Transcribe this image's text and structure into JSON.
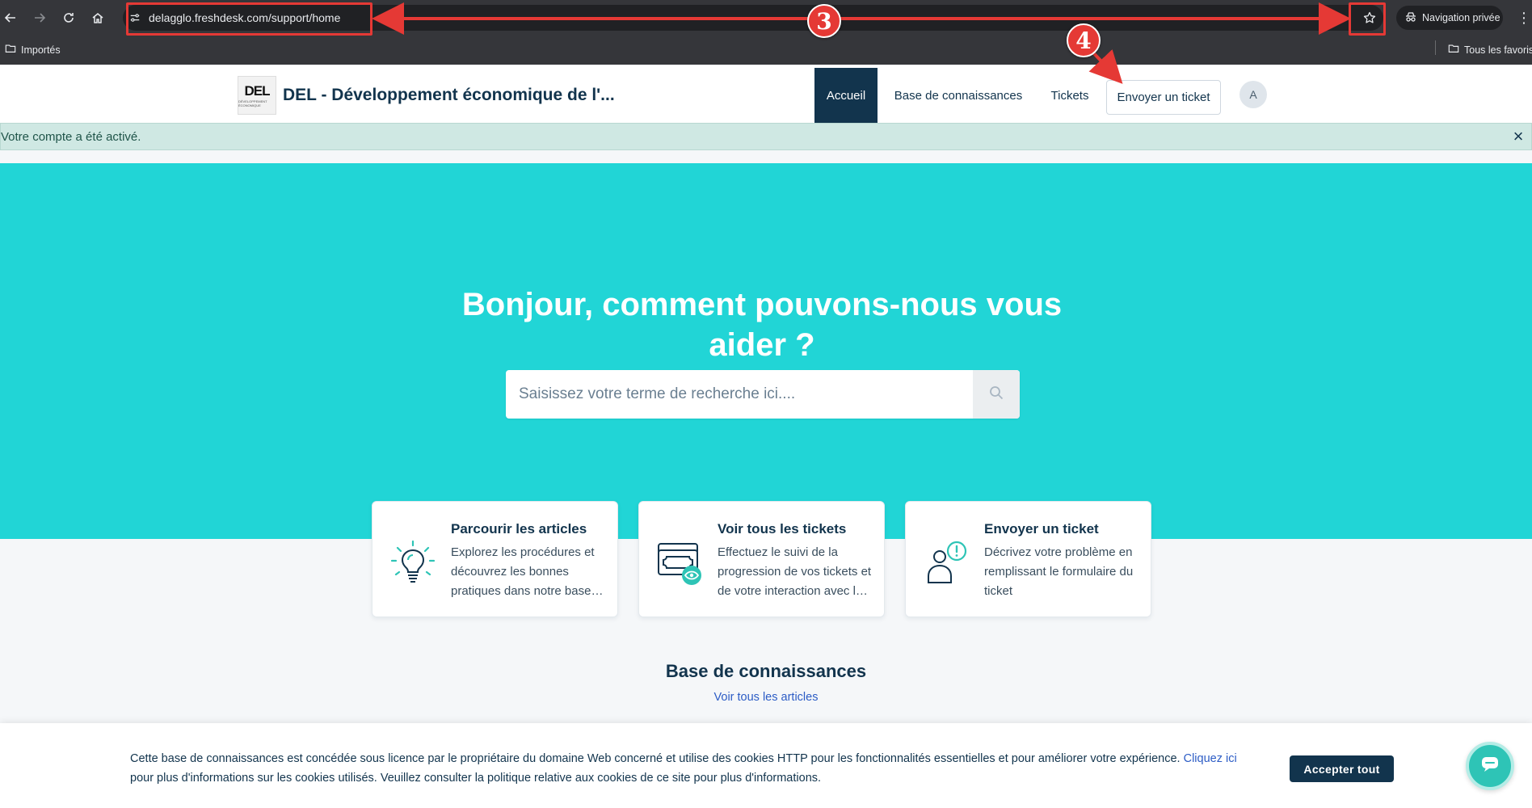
{
  "browser": {
    "url": "delagglo.freshdesk.com/support/home",
    "private_label": "Navigation privée",
    "bookmarks": [
      {
        "label": "Importés",
        "icon": "folder-icon"
      },
      {
        "label": "Tous les favoris",
        "icon": "folder-icon"
      }
    ],
    "icons": [
      "back-icon",
      "forward-icon",
      "reload-icon",
      "home-icon",
      "site-info-icon",
      "star-icon",
      "incognito-icon",
      "menu-icon"
    ]
  },
  "annotations": [
    {
      "number": "3",
      "target": "url-bar and bookmark star"
    },
    {
      "number": "4",
      "target": "Envoyer un ticket button"
    }
  ],
  "header": {
    "logo_text": "DEL",
    "logo_subtext": "DÉVELOPPEMENT ÉCONOMIQUE",
    "site_name": "DEL - Développement économique de l'...",
    "nav": {
      "home": "Accueil",
      "knowledge": "Base de connaissances",
      "tickets": "Tickets"
    },
    "submit_ticket": "Envoyer un ticket",
    "avatar_initial": "A"
  },
  "alert": {
    "message": "Votre compte a été activé.",
    "close": "×"
  },
  "hero": {
    "title": "Bonjour, comment pouvons-nous vous aider ?",
    "search_placeholder": "Saisissez votre terme de recherche ici...."
  },
  "cards": [
    {
      "title": "Parcourir les articles",
      "description": "Explorez les procédures et découvrez les bonnes pratiques dans notre base…",
      "icon": "lightbulb-icon"
    },
    {
      "title": "Voir tous les tickets",
      "description": "Effectuez le suivi de la progression de vos tickets et de votre interaction avec l…",
      "icon": "tickets-eye-icon"
    },
    {
      "title": "Envoyer un ticket",
      "description": "Décrivez votre problème en remplissant le formulaire du ticket",
      "icon": "user-alert-icon"
    }
  ],
  "knowledge_base": {
    "title": "Base de connaissances",
    "link": "Voir tous les articles"
  },
  "cookie": {
    "text": "Cette base de connaissances est concédée sous licence par le propriétaire du domaine Web concerné et utilise des cookies HTTP pour les fonctionnalités essentielles et pour améliorer votre expérience.",
    "link": "Cliquez ici",
    "text_after": "pour plus d'informations sur les cookies utilisés. Veuillez consulter la politique relative aux cookies de ce site pour plus d'informations.",
    "accept": "Accepter tout"
  },
  "colors": {
    "hero": "#21d5d6",
    "primary": "#12344d",
    "annotation": "#e53935",
    "link": "#2c5cc5"
  }
}
